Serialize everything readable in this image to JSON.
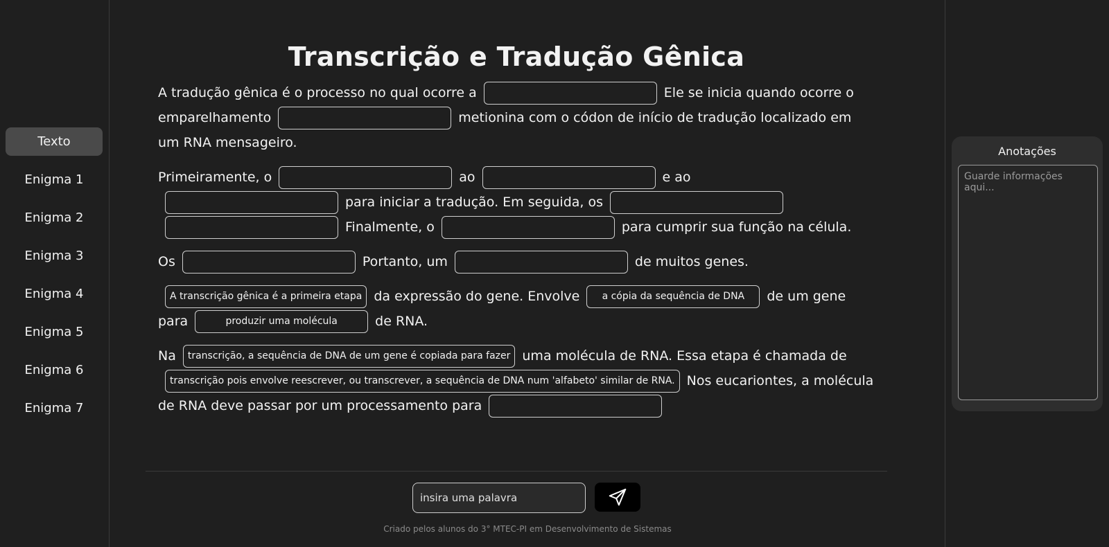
{
  "nav": {
    "items": [
      {
        "label": "Texto",
        "active": true
      },
      {
        "label": "Enigma 1"
      },
      {
        "label": "Enigma 2"
      },
      {
        "label": "Enigma 3"
      },
      {
        "label": "Enigma 4"
      },
      {
        "label": "Enigma 5"
      },
      {
        "label": "Enigma 6"
      },
      {
        "label": "Enigma 7"
      }
    ]
  },
  "main": {
    "title": "Transcrição e Tradução Gênica",
    "p1": {
      "t1": "A tradução gênica é o processo no qual ocorre a",
      "t2": "Ele se inicia quando ocorre o emparelhamento",
      "t3": "metionina com o códon de início de tradução localizado em um RNA mensageiro."
    },
    "p2": {
      "t1": "Primeiramente, o",
      "t2": "ao",
      "t3": "e ao",
      "t4": "para iniciar a tradução. Em seguida, os",
      "t5": "Finalmente, o",
      "t6": "para cumprir sua função na célula."
    },
    "p3": {
      "t1": "Os",
      "t2": "Portanto, um",
      "t3": "de muitos genes."
    },
    "p4": {
      "f1": "A transcrição gênica é a primeira etapa",
      "t1": "da expressão do gene. Envolve",
      "f2": "a cópia da sequência de DNA",
      "t2": "de um gene para",
      "f3": "produzir uma molécula",
      "t3": "de RNA."
    },
    "p5": {
      "t1": "Na",
      "f1": "transcrição, a sequência de DNA de um gene é copiada para fazer",
      "t2": "uma molécula de RNA. Essa etapa é chamada de",
      "f2": "transcrição pois envolve reescrever, ou transcrever, a sequência de DNA num 'alfabeto' similar de RNA.",
      "t3": "Nos eucariontes, a molécula de RNA deve passar por um processamento para"
    }
  },
  "input": {
    "placeholder": "insira uma palavra"
  },
  "footer": "Criado pelos alunos do 3° MTEC-PI em Desenvolvimento de Sistemas",
  "notes": {
    "title": "Anotações",
    "placeholder": "Guarde informações aqui..."
  }
}
